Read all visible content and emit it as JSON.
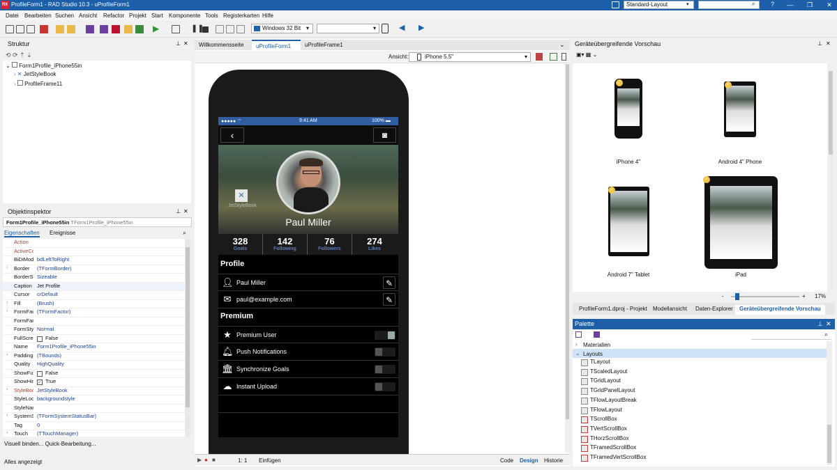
{
  "app": {
    "title": "ProfileForm1 - RAD Studio 10.3 - uProfileForm1",
    "logo": "RX",
    "layout": "Standard-Layout",
    "window_controls": [
      "—",
      "❐",
      "✕"
    ]
  },
  "menu": [
    "Datei",
    "Bearbeiten",
    "Suchen",
    "Ansicht",
    "Refactor",
    "Projekt",
    "Start",
    "Komponente",
    "Tools",
    "Registerkarten",
    "Hilfe"
  ],
  "toolbar": {
    "platform": "Windows 32 Bit"
  },
  "structure": {
    "title": "Struktur",
    "root": "Form1Profile_iPhone55in",
    "children": [
      "JetStyleBook",
      "ProfileFrame11"
    ]
  },
  "inspector": {
    "title": "Objektinspektor",
    "object": "Form1Profile_iPhone55in",
    "object_type": "TForm1Profile_iPhone55in",
    "tabs": [
      "Eigenschaften",
      "Ereignisse"
    ],
    "props": [
      {
        "name": "Action",
        "value": ""
      },
      {
        "name": "ActiveControl",
        "value": ""
      },
      {
        "name": "BiDiMode",
        "value": "bdLeftToRight"
      },
      {
        "name": "Border",
        "value": "(TFormBorder)"
      },
      {
        "name": "BorderStyle",
        "value": "Sizeable"
      },
      {
        "name": "Caption",
        "value": "Jet Profile"
      },
      {
        "name": "Cursor",
        "value": "crDefault"
      },
      {
        "name": "Fill",
        "value": "(Brush)"
      },
      {
        "name": "FormFactor",
        "value": "(TFormFactor)"
      },
      {
        "name": "FormFamily",
        "value": ""
      },
      {
        "name": "FormStyle",
        "value": "Normal"
      },
      {
        "name": "FullScreen",
        "value": "False"
      },
      {
        "name": "Name",
        "value": "Form1Profile_iPhone55in"
      },
      {
        "name": "Padding",
        "value": "(TBounds)"
      },
      {
        "name": "Quality",
        "value": "HighQuality"
      },
      {
        "name": "ShowFullScreenIcon",
        "value": "False"
      },
      {
        "name": "ShowHint",
        "value": "True"
      },
      {
        "name": "StyleBook",
        "value": "JetStyleBook"
      },
      {
        "name": "StyleLookup",
        "value": "backgroundstyle"
      },
      {
        "name": "StyleName",
        "value": ""
      },
      {
        "name": "SystemStatusBar",
        "value": "(TFormSystemStatusBar)"
      },
      {
        "name": "Tag",
        "value": "0"
      },
      {
        "name": "Touch",
        "value": "(TTouchManager)"
      }
    ],
    "footer": [
      "Visuell binden...",
      "Quick-Bearbeitung..."
    ],
    "status": "Alles angezeigt"
  },
  "designer": {
    "tabs": [
      "Willkommensseite",
      "uProfileForm1",
      "uProfileFrame1"
    ],
    "view_label": "Ansicht:",
    "device": "iPhone 5.5\"",
    "bottom": {
      "pos": "1:  1",
      "mode": "Einfügen",
      "tabs": [
        "Code",
        "Design",
        "Historie"
      ]
    }
  },
  "phone_app": {
    "statusbar": {
      "signal": "●●●●● ⌔",
      "time": "9:41 AM",
      "battery": "100% ▬"
    },
    "name": "Paul Miller",
    "stylebook_label": "JetStyleBook",
    "stats": [
      {
        "value": "328",
        "label": "Goals"
      },
      {
        "value": "142",
        "label": "Following"
      },
      {
        "value": "76",
        "label": "Followers"
      },
      {
        "value": "274",
        "label": "Likes"
      }
    ],
    "profile_header": "Profile",
    "profile_rows": [
      "Paul Miller",
      "paul@example.com"
    ],
    "premium_header": "Premium",
    "premium_rows": [
      {
        "label": "Premium User",
        "on": 1
      },
      {
        "label": "Push Notifications",
        "on": 0
      },
      {
        "label": "Synchronize Goals",
        "on": 0
      },
      {
        "label": "Instant Upload",
        "on": 0
      }
    ]
  },
  "preview": {
    "title": "Geräteübergreifende Vorschau",
    "devices": [
      "iPhone 4\"",
      "Android 4\" Phone",
      "Android 7\" Tablet",
      "iPad"
    ],
    "zoom": "17%",
    "zoom_level": 0.17,
    "tabs": [
      "ProfileForm1.dproj - Projekt",
      "Modellansicht",
      "Daten-Explorer",
      "Geräteübergreifende Vorschau"
    ]
  },
  "palette": {
    "title": "Palette",
    "categories": [
      "Materialien",
      "Layouts"
    ],
    "items": [
      "TLayout",
      "TScaledLayout",
      "TGridLayout",
      "TGridPanelLayout",
      "TFlowLayoutBreak",
      "TFlowLayout",
      "TScrollBox",
      "TVertScrollBox",
      "THorzScrollBox",
      "TFramedScrollBox",
      "TFramedVertScrollBox"
    ]
  }
}
